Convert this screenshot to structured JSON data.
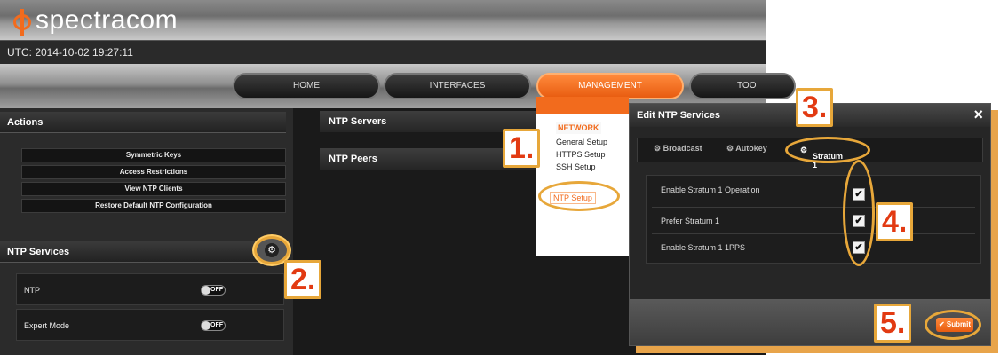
{
  "brand": {
    "name": "spectracom"
  },
  "utc": {
    "text": "UTC: 2014-10-02 19:27:11"
  },
  "nav": {
    "home": "HOME",
    "interfaces": "INTERFACES",
    "management": "MANAGEMENT",
    "tools": "TOO"
  },
  "actions": {
    "title": "Actions",
    "buttons": [
      "Symmetric Keys",
      "Access Restrictions",
      "View NTP Clients",
      "Restore Default NTP Configuration"
    ]
  },
  "ntp_services": {
    "title": "NTP Services",
    "rows": [
      {
        "label": "NTP",
        "state": "OFF"
      },
      {
        "label": "Expert Mode",
        "state": "OFF"
      }
    ]
  },
  "center": {
    "servers": "NTP Servers",
    "peers": "NTP Peers"
  },
  "menu": {
    "heading": "NETWORK",
    "items": [
      "General Setup",
      "HTTPS Setup",
      "SSH Setup"
    ],
    "ntp_setup": "NTP Setup"
  },
  "modal": {
    "title": "Edit NTP Services",
    "close": "×",
    "tabs": [
      "Broadcast",
      "Autokey",
      "Stratum 1"
    ],
    "options": [
      {
        "label": "Enable Stratum 1 Operation",
        "checked": true
      },
      {
        "label": "Prefer Stratum 1",
        "checked": true
      },
      {
        "label": "Enable Stratum 1 1PPS",
        "checked": true
      }
    ],
    "submit": "Submit"
  },
  "steps": [
    "1.",
    "2.",
    "3.",
    "4.",
    "5."
  ],
  "colors": {
    "accent": "#f26b1d",
    "callout_border": "#e7a73a",
    "callout_text": "#e23a12"
  }
}
